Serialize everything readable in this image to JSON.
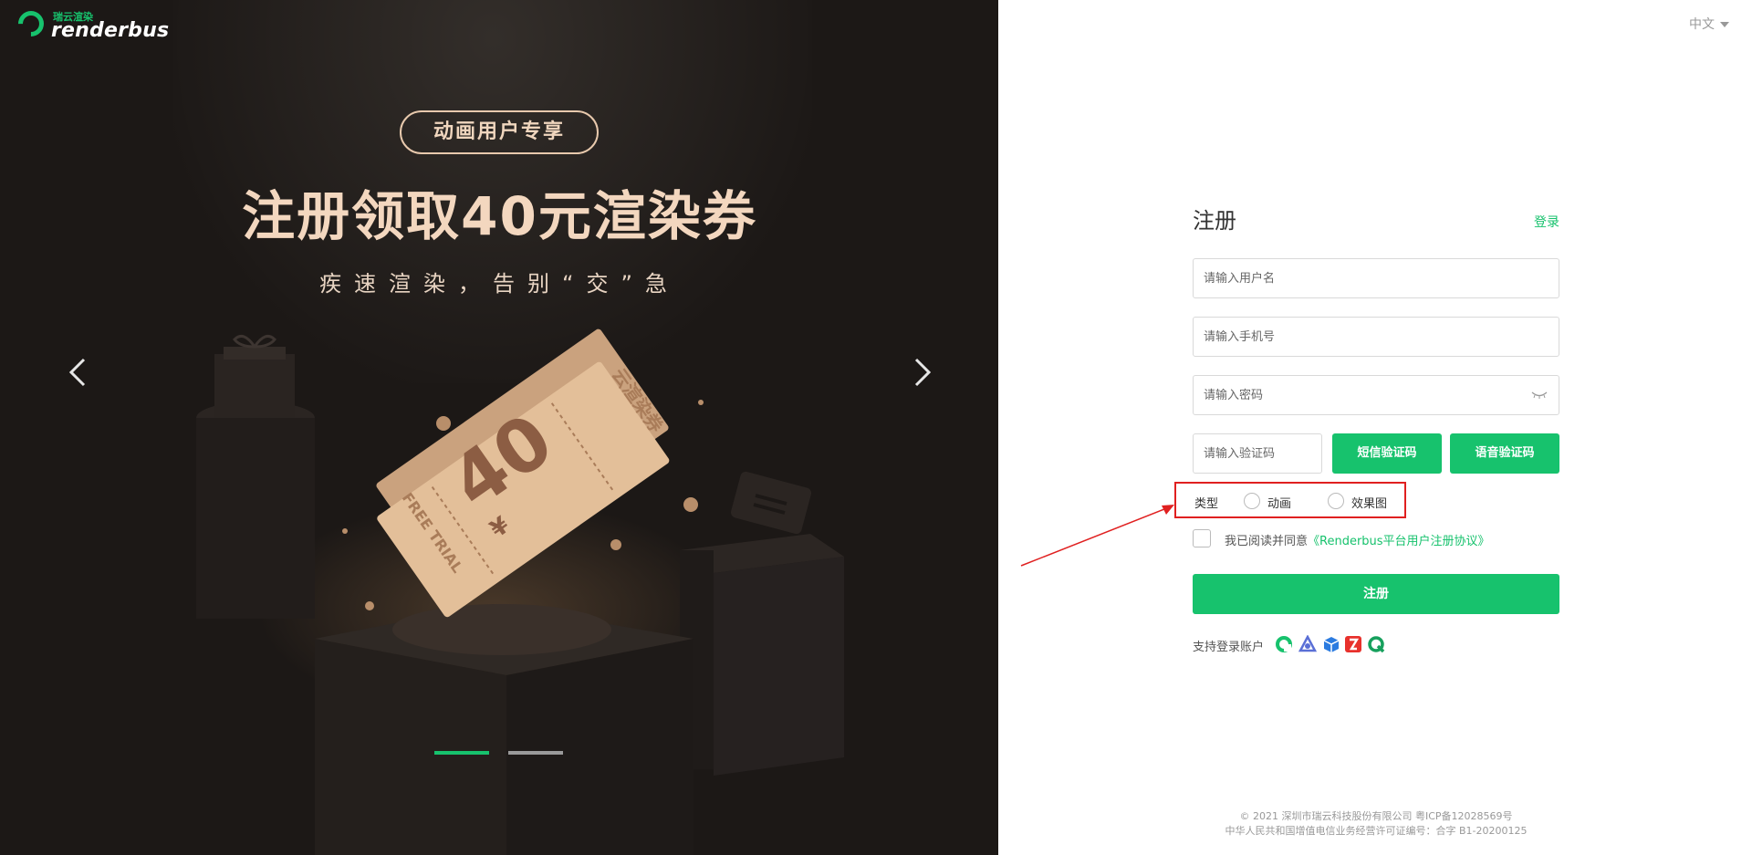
{
  "brand": {
    "small": "瑞云渲染",
    "name": "renderbus",
    "color": "#17c26d"
  },
  "banner": {
    "pill": "动画用户专享",
    "headline": "注册领取40元渲染券",
    "subline": "疾速渲染，告别“交”急",
    "ticket_text": "云渲染券",
    "ticket_value": "40",
    "ticket_currency": "¥",
    "ticket_trial": "FREE TRIAL",
    "slides": 2,
    "active_slide": 1
  },
  "header": {
    "language": "中文"
  },
  "form": {
    "title": "注册",
    "login_link": "登录",
    "username_placeholder": "请输入用户名",
    "phone_placeholder": "请输入手机号",
    "password_placeholder": "请输入密码",
    "code_placeholder": "请输入验证码",
    "sms_button": "短信验证码",
    "voice_button": "语音验证码",
    "type_label": "类型",
    "type_options": [
      "动画",
      "效果图"
    ],
    "agree_prefix": "我已阅读并同意",
    "agree_link": "《Renderbus平台用户注册协议》",
    "submit": "注册",
    "support_label": "支持登录账户"
  },
  "footer": {
    "line1": "© 2021 深圳市瑞云科技股份有限公司 粤ICP备12028569号",
    "line2": "中华人民共和国增值电信业务经营许可证编号：合字 B1-20200125"
  }
}
